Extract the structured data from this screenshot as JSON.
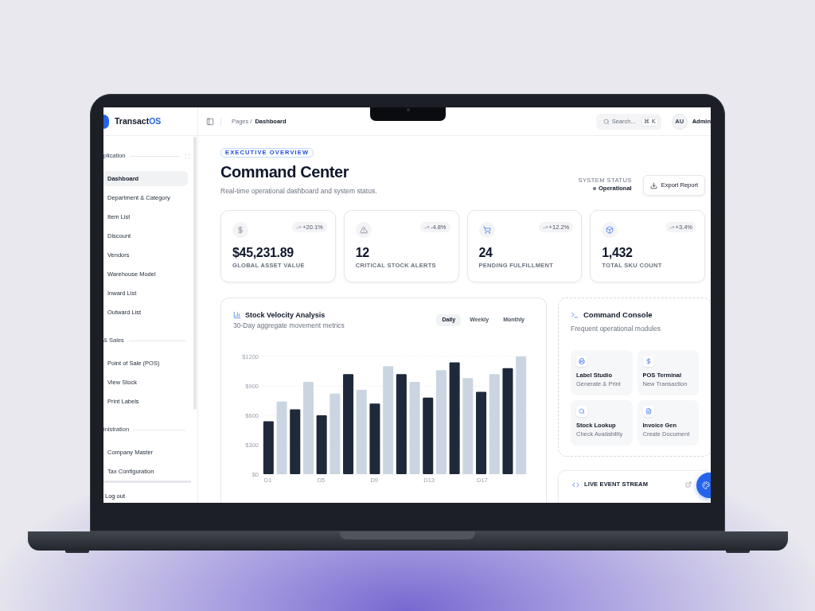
{
  "sidebar": {
    "brand": {
      "name": "Transact",
      "accent": "OS"
    },
    "sections": [
      {
        "label": "plication",
        "items": [
          {
            "label": "Dashboard",
            "selected": true
          },
          {
            "label": "Department & Category",
            "selected": false
          },
          {
            "label": "Item List",
            "selected": false
          },
          {
            "label": "Discount",
            "selected": false
          },
          {
            "label": "Vendors",
            "selected": false
          },
          {
            "label": "Warehouse Model",
            "selected": false
          },
          {
            "label": "Inward List",
            "selected": false
          },
          {
            "label": "Outward List",
            "selected": false
          }
        ]
      },
      {
        "label": "& Sales",
        "items": [
          {
            "label": "Point of Sale (POS)",
            "selected": false
          },
          {
            "label": "View Stock",
            "selected": false
          },
          {
            "label": "Print Labels",
            "selected": false
          }
        ]
      },
      {
        "label": "inistration",
        "items": [
          {
            "label": "Company Master",
            "selected": false
          },
          {
            "label": "Tax Configuration",
            "selected": false
          }
        ]
      }
    ],
    "footer": "Log out"
  },
  "header": {
    "breadcrumb": [
      {
        "label": "Pages /",
        "current": false
      },
      {
        "label": "Dashboard",
        "current": true
      }
    ],
    "search": {
      "placeholder": "Search...",
      "shortcut": "⌘ K"
    },
    "user": {
      "initials": "AU",
      "name": "Admin"
    }
  },
  "page": {
    "eyebrow": "EXECUTIVE OVERVIEW",
    "title": "Command Center",
    "subtitle": "Real-time operational dashboard and system status.",
    "system_status": {
      "label": "SYSTEM STATUS",
      "value": "Operational"
    },
    "export_button": "Export Report"
  },
  "stats": [
    {
      "value": "$45,231.89",
      "label": "GLOBAL ASSET VALUE",
      "trend": "+20.1%"
    },
    {
      "value": "12",
      "label": "CRITICAL STOCK ALERTS",
      "trend": "-4.8%"
    },
    {
      "value": "24",
      "label": "PENDING FULFILLMENT",
      "trend": "+12.2%"
    },
    {
      "value": "1,432",
      "label": "TOTAL SKU COUNT",
      "trend": "+3.4%"
    }
  ],
  "chart_card": {
    "title": "Stock Velocity Analysis",
    "subtitle": "30-Day aggregate movement metrics",
    "tabs": [
      {
        "label": "Daily",
        "selected": true
      },
      {
        "label": "Weekly",
        "selected": false
      },
      {
        "label": "Monthly",
        "selected": false
      }
    ],
    "chart_data": {
      "type": "bar",
      "categories": [
        "D1",
        null,
        null,
        null,
        "D5",
        null,
        null,
        null,
        "D9",
        null,
        null,
        null,
        "D13",
        null,
        null,
        null,
        "D17",
        null,
        null,
        null
      ],
      "series": [
        {
          "values": [
            540,
            740,
            660,
            940,
            600,
            820,
            1020,
            860,
            720,
            1100,
            1020,
            940,
            780,
            1060,
            1140,
            980,
            840,
            1020,
            1080,
            1200
          ]
        }
      ],
      "colors": [
        "#1e293b",
        "#cbd5e1"
      ],
      "ylim": [
        0,
        1200
      ],
      "yticks": [
        {
          "value": 0,
          "label": "$0"
        },
        {
          "value": 300,
          "label": "$300"
        },
        {
          "value": 600,
          "label": "$600"
        },
        {
          "value": 900,
          "label": "$900"
        },
        {
          "value": 1200,
          "label": "$1200"
        }
      ],
      "grid": true
    }
  },
  "console": {
    "title": "Command Console",
    "subtitle": "Frequent operational modules",
    "modules": [
      {
        "title": "Label Studio",
        "subtitle": "Generate & Print"
      },
      {
        "title": "POS Terminal",
        "subtitle": "New Transaction"
      },
      {
        "title": "Stock Lookup",
        "subtitle": "Check Availability"
      },
      {
        "title": "Invoice Gen",
        "subtitle": "Create Document"
      }
    ]
  },
  "event_stream": {
    "title": "LIVE EVENT STREAM"
  }
}
